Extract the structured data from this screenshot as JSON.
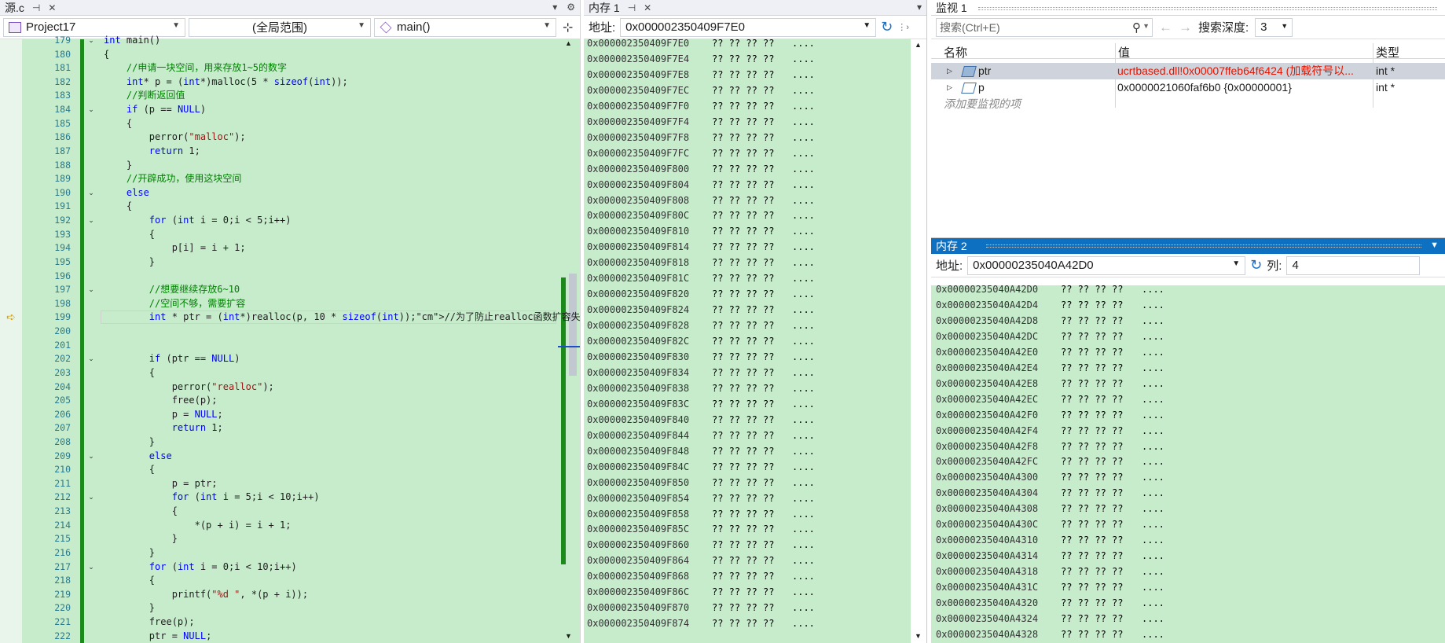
{
  "editor": {
    "tab_title": "源.c",
    "pin": "⊣",
    "close": "✕",
    "project": "Project17",
    "scope": "(全局范围)",
    "function": "main()",
    "lines": [
      {
        "n": "179",
        "t": "int main()",
        "fold": "v"
      },
      {
        "n": "180",
        "t": "{",
        "fold": ""
      },
      {
        "n": "181",
        "t": "    //申请一块空间，用来存放1~5的数字",
        "fold": ""
      },
      {
        "n": "182",
        "t": "    int* p = (int*)malloc(5 * sizeof(int));",
        "fold": ""
      },
      {
        "n": "183",
        "t": "    //判断返回值",
        "fold": ""
      },
      {
        "n": "184",
        "t": "    if (p == NULL)",
        "fold": "v"
      },
      {
        "n": "185",
        "t": "    {",
        "fold": ""
      },
      {
        "n": "186",
        "t": "        perror(\"malloc\");",
        "fold": ""
      },
      {
        "n": "187",
        "t": "        return 1;",
        "fold": ""
      },
      {
        "n": "188",
        "t": "    }",
        "fold": ""
      },
      {
        "n": "189",
        "t": "    //开辟成功，使用这块空间",
        "fold": ""
      },
      {
        "n": "190",
        "t": "    else",
        "fold": "v"
      },
      {
        "n": "191",
        "t": "    {",
        "fold": ""
      },
      {
        "n": "192",
        "t": "        for (int i = 0;i < 5;i++)",
        "fold": "v"
      },
      {
        "n": "193",
        "t": "        {",
        "fold": ""
      },
      {
        "n": "194",
        "t": "            p[i] = i + 1;",
        "fold": ""
      },
      {
        "n": "195",
        "t": "        }",
        "fold": ""
      },
      {
        "n": "196",
        "t": "",
        "fold": ""
      },
      {
        "n": "197",
        "t": "        //想要继续存放6~10",
        "fold": "v"
      },
      {
        "n": "198",
        "t": "        //空间不够，需要扩容",
        "fold": ""
      },
      {
        "n": "199",
        "t": "        int * ptr = (int*)realloc(p, 10 * sizeof(int));//为了防止realloc函数扩容失",
        "fold": ""
      },
      {
        "n": "200",
        "t": "",
        "fold": ""
      },
      {
        "n": "201",
        "t": "",
        "fold": ""
      },
      {
        "n": "202",
        "t": "        if (ptr == NULL)",
        "fold": "v"
      },
      {
        "n": "203",
        "t": "        {",
        "fold": ""
      },
      {
        "n": "204",
        "t": "            perror(\"realloc\");",
        "fold": ""
      },
      {
        "n": "205",
        "t": "            free(p);",
        "fold": ""
      },
      {
        "n": "206",
        "t": "            p = NULL;",
        "fold": ""
      },
      {
        "n": "207",
        "t": "            return 1;",
        "fold": ""
      },
      {
        "n": "208",
        "t": "        }",
        "fold": ""
      },
      {
        "n": "209",
        "t": "        else",
        "fold": "v"
      },
      {
        "n": "210",
        "t": "        {",
        "fold": ""
      },
      {
        "n": "211",
        "t": "            p = ptr;",
        "fold": ""
      },
      {
        "n": "212",
        "t": "            for (int i = 5;i < 10;i++)",
        "fold": "v"
      },
      {
        "n": "213",
        "t": "            {",
        "fold": ""
      },
      {
        "n": "214",
        "t": "                *(p + i) = i + 1;",
        "fold": ""
      },
      {
        "n": "215",
        "t": "            }",
        "fold": ""
      },
      {
        "n": "216",
        "t": "        }",
        "fold": ""
      },
      {
        "n": "217",
        "t": "        for (int i = 0;i < 10;i++)",
        "fold": "v"
      },
      {
        "n": "218",
        "t": "        {",
        "fold": ""
      },
      {
        "n": "219",
        "t": "            printf(\"%d \", *(p + i));",
        "fold": ""
      },
      {
        "n": "220",
        "t": "        }",
        "fold": ""
      },
      {
        "n": "221",
        "t": "        free(p);",
        "fold": ""
      },
      {
        "n": "222",
        "t": "        ptr = NULL;",
        "fold": ""
      }
    ],
    "current_line": "199"
  },
  "memory1": {
    "title": "内存 1",
    "addr_label": "地址:",
    "address": "0x000002350409F7E0",
    "rows": [
      "0x000002350409F7E0",
      "0x000002350409F7E4",
      "0x000002350409F7E8",
      "0x000002350409F7EC",
      "0x000002350409F7F0",
      "0x000002350409F7F4",
      "0x000002350409F7F8",
      "0x000002350409F7FC",
      "0x000002350409F800",
      "0x000002350409F804",
      "0x000002350409F808",
      "0x000002350409F80C",
      "0x000002350409F810",
      "0x000002350409F814",
      "0x000002350409F818",
      "0x000002350409F81C",
      "0x000002350409F820",
      "0x000002350409F824",
      "0x000002350409F828",
      "0x000002350409F82C",
      "0x000002350409F830",
      "0x000002350409F834",
      "0x000002350409F838",
      "0x000002350409F83C",
      "0x000002350409F840",
      "0x000002350409F844",
      "0x000002350409F848",
      "0x000002350409F84C",
      "0x000002350409F850",
      "0x000002350409F854",
      "0x000002350409F858",
      "0x000002350409F85C",
      "0x000002350409F860",
      "0x000002350409F864",
      "0x000002350409F868",
      "0x000002350409F86C",
      "0x000002350409F870",
      "0x000002350409F874"
    ],
    "bytes": "?? ?? ?? ??",
    "chars": "...."
  },
  "watch": {
    "title": "监视 1",
    "search_placeholder": "搜索(Ctrl+E)",
    "depth_label": "搜索深度:",
    "depth_value": "3",
    "col_name": "名称",
    "col_value": "值",
    "col_type": "类型",
    "items": [
      {
        "name": "ptr",
        "value": "ucrtbased.dll!0x00007ffeb64f6424 (加载符号以...",
        "type": "int *"
      },
      {
        "name": "p",
        "value": "0x0000021060faf6b0 {0x00000001}",
        "type": "int *"
      }
    ],
    "add_item": "添加要监视的项"
  },
  "memory2": {
    "title": "内存 2",
    "addr_label": "地址:",
    "address": "0x00000235040A42D0",
    "col_label": "列:",
    "col_value": "4",
    "rows": [
      "0x00000235040A42D0",
      "0x00000235040A42D4",
      "0x00000235040A42D8",
      "0x00000235040A42DC",
      "0x00000235040A42E0",
      "0x00000235040A42E4",
      "0x00000235040A42E8",
      "0x00000235040A42EC",
      "0x00000235040A42F0",
      "0x00000235040A42F4",
      "0x00000235040A42F8",
      "0x00000235040A42FC",
      "0x00000235040A4300",
      "0x00000235040A4304",
      "0x00000235040A4308",
      "0x00000235040A430C",
      "0x00000235040A4310",
      "0x00000235040A4314",
      "0x00000235040A4318",
      "0x00000235040A431C",
      "0x00000235040A4320",
      "0x00000235040A4324",
      "0x00000235040A4328"
    ],
    "bytes": "?? ?? ?? ??",
    "chars": "...."
  }
}
